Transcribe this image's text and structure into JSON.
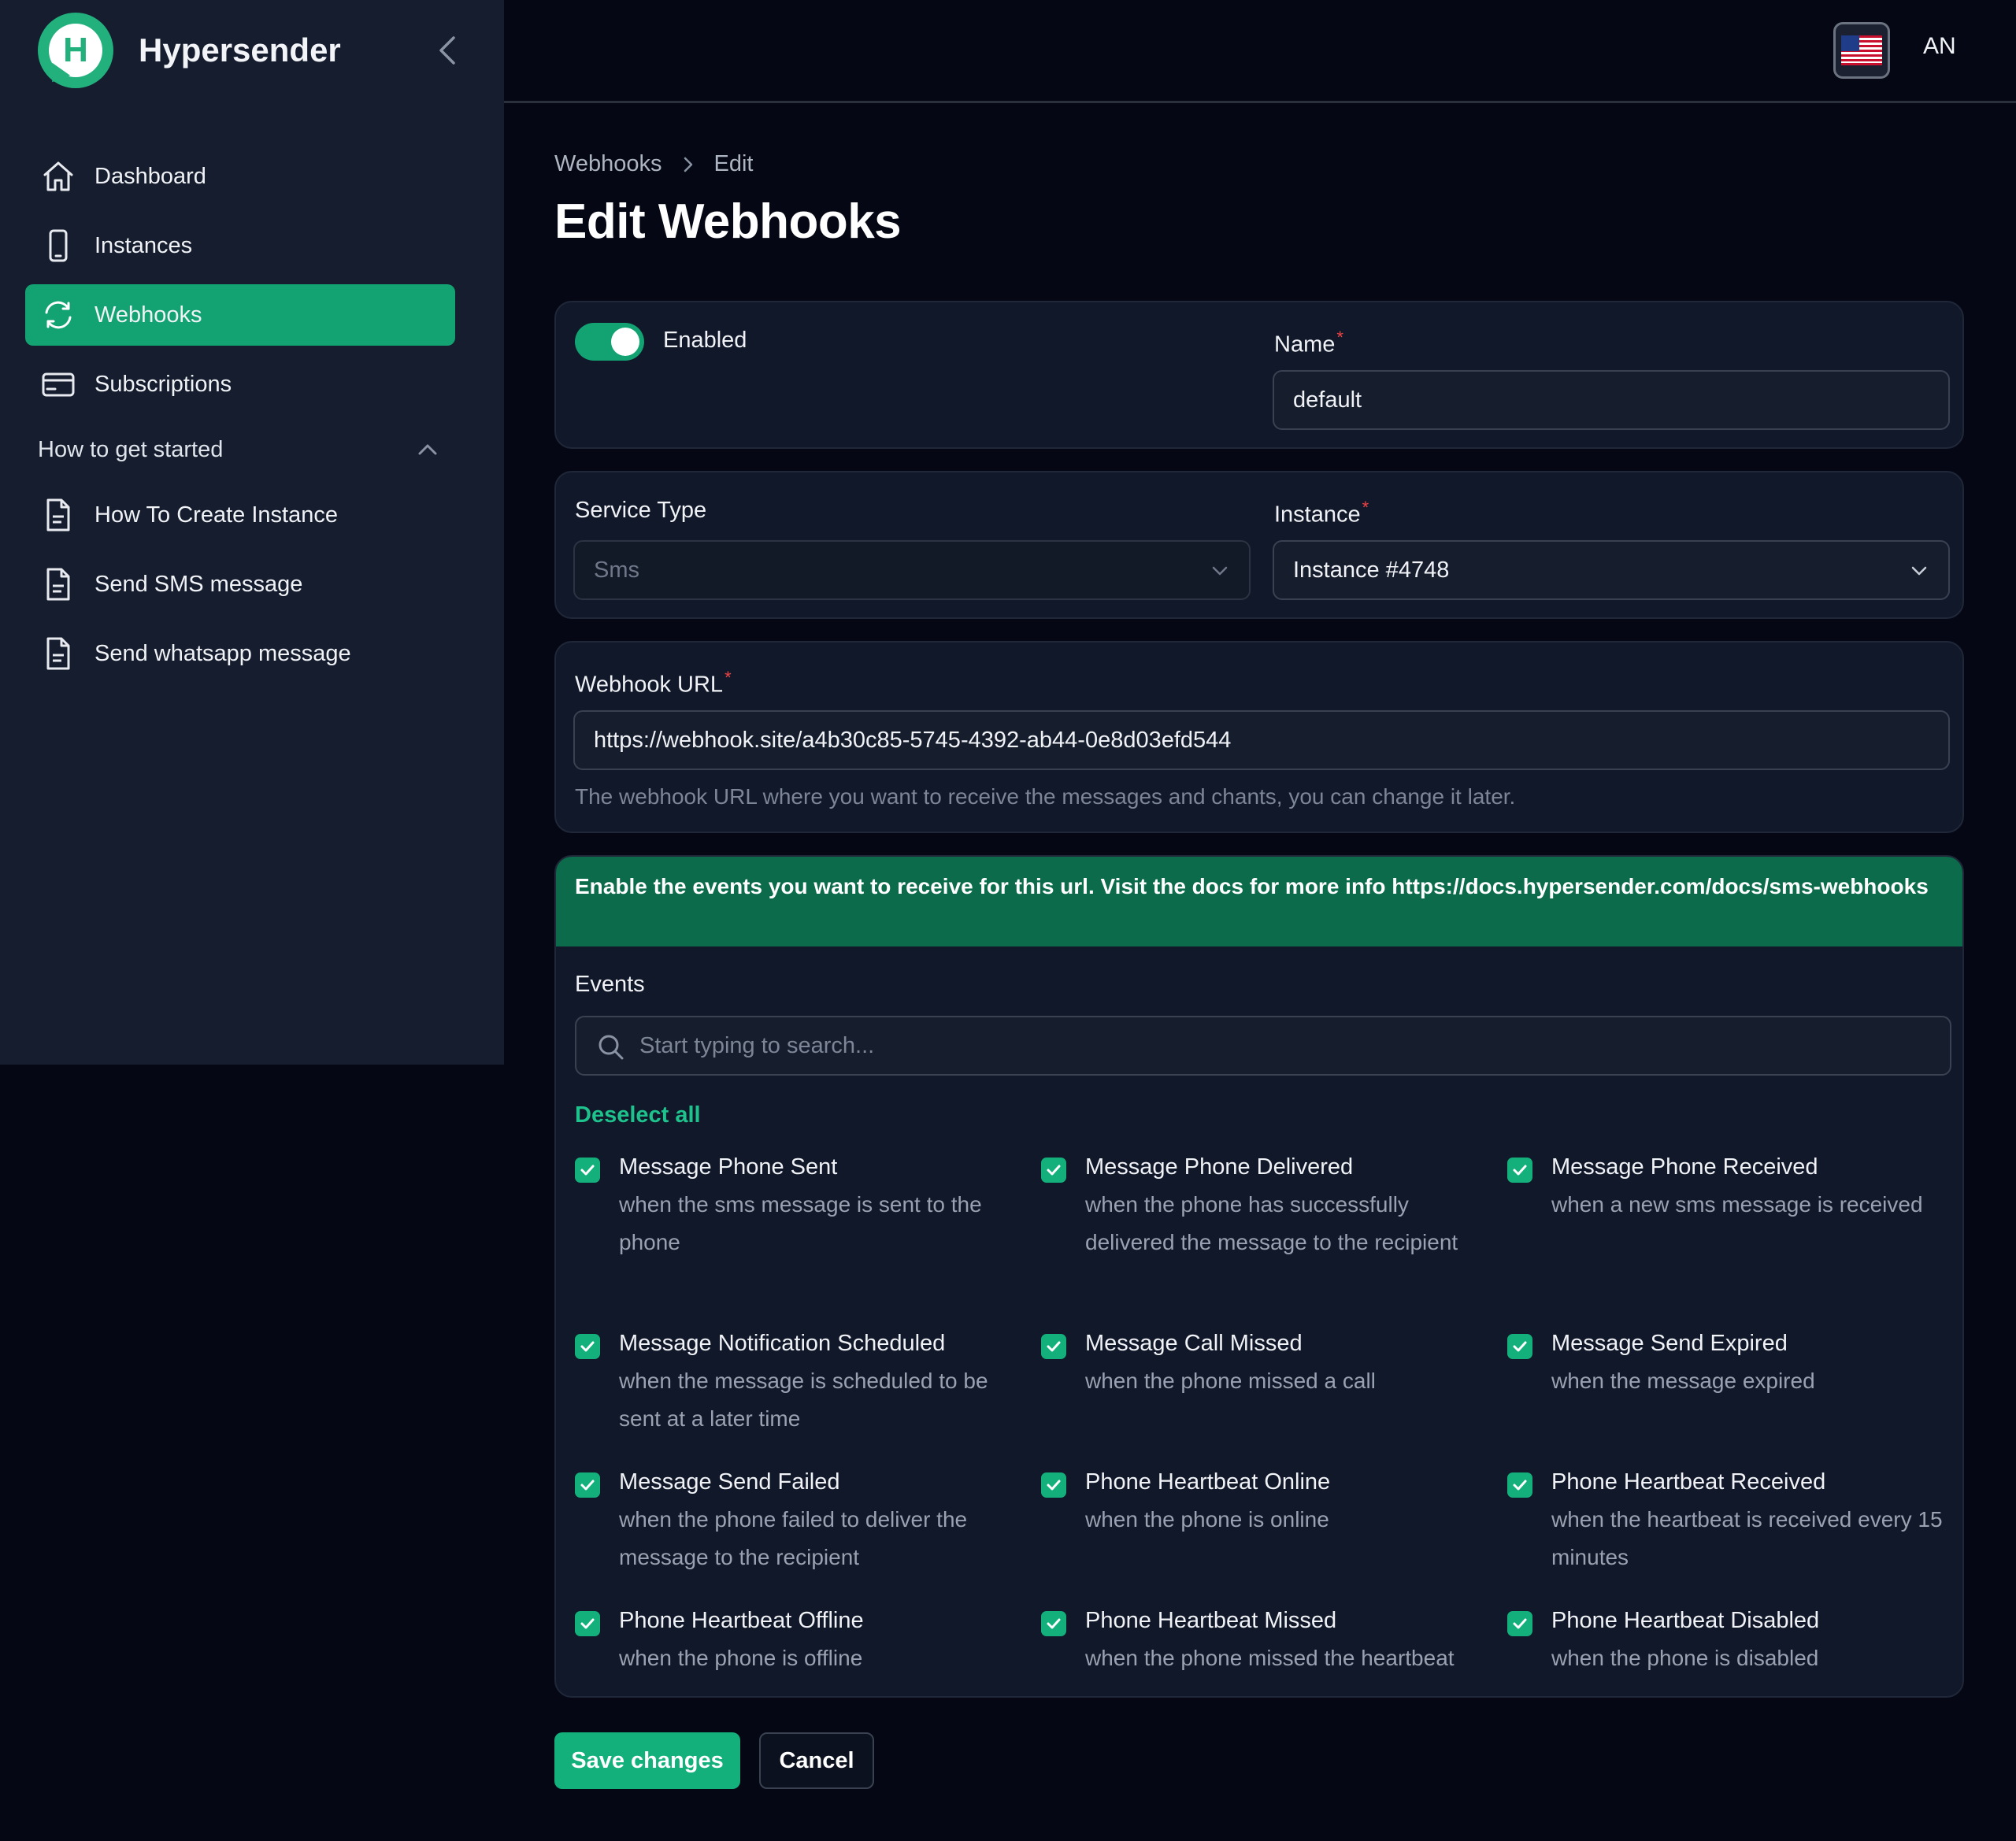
{
  "app": {
    "name": "Hypersender",
    "logo_letter": "H"
  },
  "sidebar": {
    "items": [
      {
        "label": "Dashboard",
        "icon": "home-icon",
        "active": false
      },
      {
        "label": "Instances",
        "icon": "phone-icon",
        "active": false
      },
      {
        "label": "Webhooks",
        "icon": "refresh-icon",
        "active": true
      },
      {
        "label": "Subscriptions",
        "icon": "credit-card-icon",
        "active": false
      }
    ],
    "group": {
      "label": "How to get started",
      "expanded": true,
      "items": [
        {
          "label": "How To Create Instance",
          "icon": "document-icon"
        },
        {
          "label": "Send SMS message",
          "icon": "document-icon"
        },
        {
          "label": "Send whatsapp message",
          "icon": "document-icon"
        }
      ]
    }
  },
  "topbar": {
    "locale_icon": "us-flag-icon",
    "user_initials": "AN"
  },
  "breadcrumb": {
    "parent": "Webhooks",
    "current": "Edit"
  },
  "page": {
    "title": "Edit Webhooks"
  },
  "form": {
    "enabled": {
      "label": "Enabled",
      "value": true
    },
    "name": {
      "label": "Name",
      "required_mark": "*",
      "value": "default"
    },
    "service_type": {
      "label": "Service Type",
      "value": "Sms",
      "disabled": true
    },
    "instance": {
      "label": "Instance",
      "required_mark": "*",
      "value": "Instance #4748"
    },
    "webhook_url": {
      "label": "Webhook URL",
      "required_mark": "*",
      "value": "https://webhook.site/a4b30c85-5745-4392-ab44-0e8d03efd544",
      "hint": "The webhook URL where you want to receive the messages and chants, you can change it later."
    },
    "events": {
      "banner": "Enable the events you want to receive for this url. Visit the docs for more info https://docs.hypersender.com/docs/sms-webhooks",
      "label": "Events",
      "search_placeholder": "Start typing to search...",
      "deselect_all": "Deselect all",
      "items": [
        {
          "title": "Message Phone Sent",
          "desc": "when the sms message is sent to the phone",
          "checked": true
        },
        {
          "title": "Message Phone Delivered",
          "desc": "when the phone has successfully delivered the message to the recipient",
          "checked": true
        },
        {
          "title": "Message Phone Received",
          "desc": "when a new sms message is received",
          "checked": true
        },
        {
          "title": "Message Notification Scheduled",
          "desc": "when the message is scheduled to be sent at a later time",
          "checked": true
        },
        {
          "title": "Message Call Missed",
          "desc": "when the phone missed a call",
          "checked": true
        },
        {
          "title": "Message Send Expired",
          "desc": "when the message expired",
          "checked": true
        },
        {
          "title": "Message Send Failed",
          "desc": "when the phone failed to deliver the message to the recipient",
          "checked": true
        },
        {
          "title": "Phone Heartbeat Online",
          "desc": "when the phone is online",
          "checked": true
        },
        {
          "title": "Phone Heartbeat Received",
          "desc": "when the heartbeat is received every 15 minutes",
          "checked": true
        },
        {
          "title": "Phone Heartbeat Offline",
          "desc": "when the phone is offline",
          "checked": true
        },
        {
          "title": "Phone Heartbeat Missed",
          "desc": "when the phone missed the heartbeat",
          "checked": true
        },
        {
          "title": "Phone Heartbeat Disabled",
          "desc": "when the phone is disabled",
          "checked": true
        }
      ]
    }
  },
  "actions": {
    "save": "Save changes",
    "cancel": "Cancel"
  },
  "colors": {
    "accent": "#13a372",
    "background": "#050814",
    "sidebar": "#151d2e",
    "card": "#111829",
    "banner": "#0b6b4a",
    "required": "#ef4444"
  }
}
